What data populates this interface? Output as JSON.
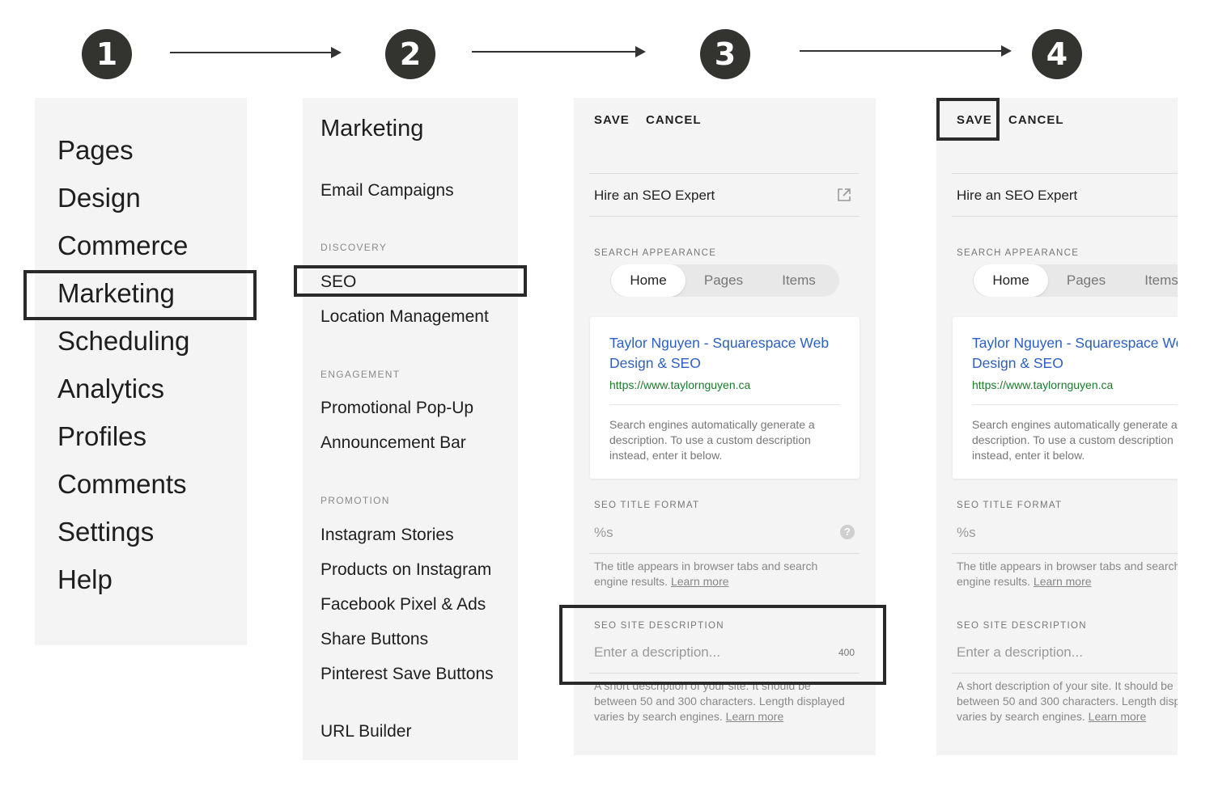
{
  "steps": [
    "1",
    "2",
    "3",
    "4"
  ],
  "panel1": {
    "items": [
      "Pages",
      "Design",
      "Commerce",
      "Marketing",
      "Scheduling",
      "Analytics",
      "Profiles",
      "Comments",
      "Settings",
      "Help"
    ]
  },
  "panel2": {
    "title": "Marketing",
    "email": "Email Campaigns",
    "discovery_label": "DISCOVERY",
    "seo": "SEO",
    "location": "Location Management",
    "engagement_label": "ENGAGEMENT",
    "popup": "Promotional Pop-Up",
    "announcement": "Announcement Bar",
    "promotion_label": "PROMOTION",
    "instagram_stories": "Instagram Stories",
    "products_instagram": "Products on Instagram",
    "facebook": "Facebook Pixel & Ads",
    "share": "Share Buttons",
    "pinterest": "Pinterest Save Buttons",
    "url_builder": "URL Builder"
  },
  "seo_panel": {
    "save": "SAVE",
    "cancel": "CANCEL",
    "hire": "Hire an SEO Expert",
    "search_appearance_label": "SEARCH APPEARANCE",
    "tabs": [
      "Home",
      "Pages",
      "Items"
    ],
    "preview_title": "Taylor Nguyen - Squarespace Web Design & SEO",
    "preview_url": "https://www.taylornguyen.ca",
    "preview_desc": "Search engines automatically generate a description. To use a custom description instead, enter it below.",
    "title_format_label": "SEO TITLE FORMAT",
    "title_format_value": "%s",
    "help_glyph": "?",
    "title_note": "The title appears in browser tabs and search engine results.",
    "learn_more": "Learn more",
    "site_desc_label": "SEO SITE DESCRIPTION",
    "site_desc_placeholder": "Enter a description...",
    "char_count": "400",
    "desc_note": "A short description of your site. It should be between 50 and 300 characters. Length displayed varies by search engines."
  },
  "colors": {
    "link_blue": "#2a5fc5",
    "url_green": "#1a7a2c",
    "panel_bg": "#f4f4f4",
    "step_circle": "#333330"
  }
}
